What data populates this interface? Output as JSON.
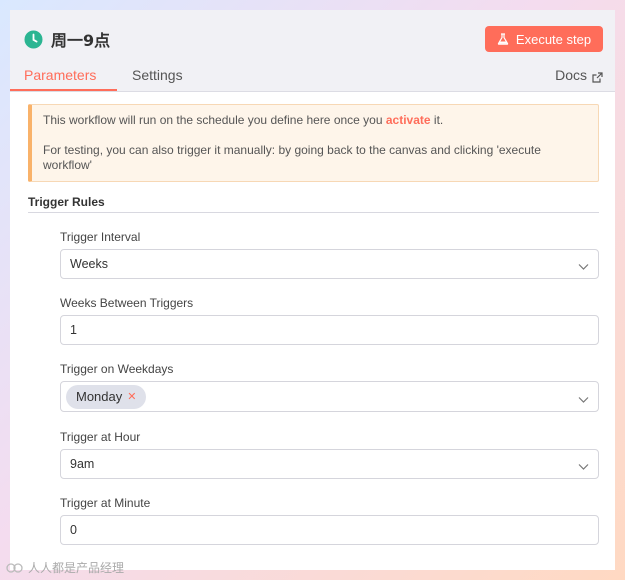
{
  "header": {
    "title": "周一9点",
    "execute_label": "Execute step",
    "tabs": [
      {
        "label": "Parameters"
      },
      {
        "label": "Settings"
      }
    ],
    "docs_label": "Docs"
  },
  "notice": {
    "line1_before": "This workflow will run on the schedule you define here once you ",
    "line1_link": "activate",
    "line1_after": " it.",
    "line2": "For testing, you can also trigger it manually: by going back to the canvas and clicking 'execute workflow'"
  },
  "section": {
    "title": "Trigger Rules"
  },
  "fields": {
    "interval": {
      "label": "Trigger Interval",
      "value": "Weeks"
    },
    "weeks_between": {
      "label": "Weeks Between Triggers",
      "value": "1"
    },
    "weekdays": {
      "label": "Trigger on Weekdays",
      "tags": [
        "Monday"
      ]
    },
    "hour": {
      "label": "Trigger at Hour",
      "value": "9am"
    },
    "minute": {
      "label": "Trigger at Minute",
      "value": "0"
    }
  },
  "watermark": "人人都是产品经理",
  "colors": {
    "accent": "#ff6d5a",
    "clock": "#2bb592",
    "notice_border": "#f9b26a"
  },
  "icons": [
    "clock-icon",
    "flask-icon",
    "external-link-icon",
    "chevron-down-icon",
    "remove-tag-icon"
  ]
}
